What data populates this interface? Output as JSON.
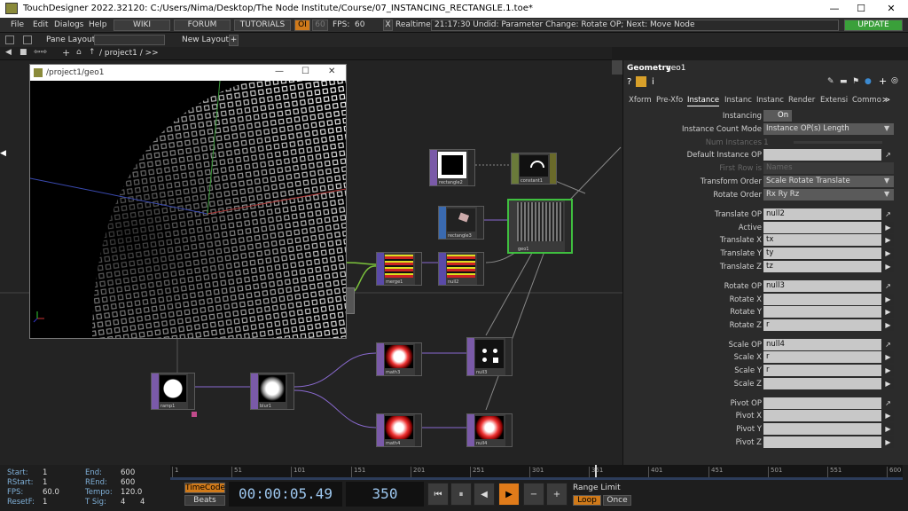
{
  "window": {
    "title": "TouchDesigner 2022.32120: C:/Users/Nima/Desktop/The Node Institute/Course/07_INSTANCING_RECTANGLE.1.toe*",
    "minimize": "—",
    "maximize": "☐",
    "close": "✕"
  },
  "menu": {
    "items": [
      "File",
      "Edit",
      "Dialogs",
      "Help"
    ],
    "wiki": "WIKI",
    "forum": "FORUM",
    "tutorials": "TUTORIALS",
    "oi": "OI",
    "fps_label": "60",
    "fps_text": "FPS:",
    "fps_value": "60",
    "realtime_check": "X",
    "realtime": "Realtime",
    "status": "21:17:30 Undid: Parameter Change: Rotate OP; Next: Move Node",
    "update": "UPDATE"
  },
  "toolbar": {
    "pane_layout": "Pane Layout",
    "new_layout": "New Layout",
    "plus": "+"
  },
  "pathbar": {
    "path": "/ project1 / >>"
  },
  "viewer": {
    "title": "/project1/geo1"
  },
  "nodes": [
    {
      "id": "rectangle2",
      "label": "rectangle2"
    },
    {
      "id": "constant1",
      "label": "constant1"
    },
    {
      "id": "rectangle3",
      "label": "rectangle3"
    },
    {
      "id": "geo1",
      "label": "geo1"
    },
    {
      "id": "merge1",
      "label": "merge1"
    },
    {
      "id": "null2",
      "label": "null2"
    },
    {
      "id": "math3",
      "label": "math3"
    },
    {
      "id": "null3",
      "label": "null3"
    },
    {
      "id": "ramp1",
      "label": "ramp1"
    },
    {
      "id": "blur1",
      "label": "blur1"
    },
    {
      "id": "math4",
      "label": "math4"
    },
    {
      "id": "null4",
      "label": "null4"
    }
  ],
  "params": {
    "op_type": "Geometry",
    "op_name": "geo1",
    "tabs": [
      "Xform",
      "Pre-Xfo",
      "Instance",
      "Instanc",
      "Instanc",
      "Render",
      "Extensi",
      "Commo"
    ],
    "active_tab": "Instance",
    "rows": {
      "instancing": {
        "label": "Instancing",
        "value": "On"
      },
      "count_mode": {
        "label": "Instance Count Mode",
        "value": "Instance OP(s) Length"
      },
      "num_instances": {
        "label": "Num Instances",
        "value": "1"
      },
      "default_op": {
        "label": "Default Instance OP",
        "value": ""
      },
      "first_row_is": {
        "label": "First Row is",
        "value": "Names"
      },
      "transform_order": {
        "label": "Transform Order",
        "value": "Scale Rotate Translate"
      },
      "rotate_order": {
        "label": "Rotate Order",
        "value": "Rx Ry Rz"
      },
      "translate_op": {
        "label": "Translate OP",
        "value": "null2"
      },
      "active": {
        "label": "Active",
        "value": ""
      },
      "translate_x": {
        "label": "Translate X",
        "value": "tx"
      },
      "translate_y": {
        "label": "Translate Y",
        "value": "ty"
      },
      "translate_z": {
        "label": "Translate Z",
        "value": "tz"
      },
      "rotate_op": {
        "label": "Rotate OP",
        "value": "null3"
      },
      "rotate_x": {
        "label": "Rotate X",
        "value": ""
      },
      "rotate_y": {
        "label": "Rotate Y",
        "value": ""
      },
      "rotate_z": {
        "label": "Rotate Z",
        "value": "r"
      },
      "scale_op": {
        "label": "Scale OP",
        "value": "null4"
      },
      "scale_x": {
        "label": "Scale X",
        "value": "r"
      },
      "scale_y": {
        "label": "Scale Y",
        "value": "r"
      },
      "scale_z": {
        "label": "Scale Z",
        "value": ""
      },
      "pivot_op": {
        "label": "Pivot OP",
        "value": ""
      },
      "pivot_x": {
        "label": "Pivot X",
        "value": ""
      },
      "pivot_y": {
        "label": "Pivot Y",
        "value": ""
      },
      "pivot_z": {
        "label": "Pivot Z",
        "value": ""
      }
    }
  },
  "timeline": {
    "ticks": [
      "1",
      "51",
      "101",
      "151",
      "201",
      "251",
      "301",
      "351",
      "401",
      "451",
      "501",
      "551",
      "600"
    ],
    "timecode_btn": "TimeCode",
    "beats_btn": "Beats",
    "timecode": "00:00:05.49",
    "frame": "350",
    "range_limit": "Range Limit",
    "loop": "Loop",
    "once": "Once",
    "play_progress": 0.58
  },
  "stats": {
    "start": "Start:",
    "start_v": "1",
    "end": "End:",
    "end_v": "600",
    "rstart": "RStart:",
    "rstart_v": "1",
    "rend": "REnd:",
    "rend_v": "600",
    "fps": "FPS:",
    "fps_v": "60.0",
    "tempo": "Tempo:",
    "tempo_v": "120.0",
    "resetf": "ResetF:",
    "resetf_v": "1",
    "tsig": "T Sig:",
    "tsig_a": "4",
    "tsig_b": "4"
  },
  "colors": {
    "geo_highlight": "#3fbf3f",
    "update_bg": "#3aa03a",
    "play_bg": "#e07b1a",
    "top_node": "#7a5aa8",
    "chop_node": "#5a4aa8"
  }
}
